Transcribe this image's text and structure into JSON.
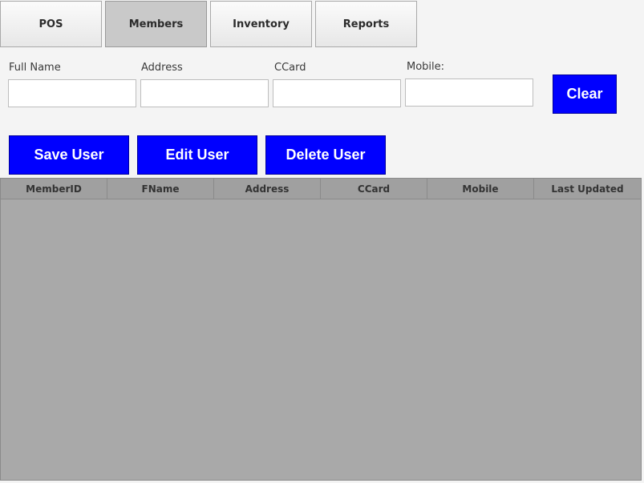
{
  "tabs": [
    {
      "label": "POS"
    },
    {
      "label": "Members"
    },
    {
      "label": "Inventory"
    },
    {
      "label": "Reports"
    }
  ],
  "active_tab": "Members",
  "form": {
    "full_name": {
      "label": "Full Name",
      "value": ""
    },
    "address": {
      "label": "Address",
      "value": ""
    },
    "ccard": {
      "label": "CCard",
      "value": ""
    },
    "mobile": {
      "label": "Mobile:",
      "value": ""
    }
  },
  "buttons": {
    "clear": "Clear",
    "save_user": "Save User",
    "edit_user": "Edit User",
    "delete_user": "Delete User"
  },
  "table": {
    "columns": [
      "MemberID",
      "FName",
      "Address",
      "CCard",
      "Mobile",
      "Last Updated"
    ],
    "rows": []
  },
  "colors": {
    "button_bg": "#0000ff",
    "grid_bg": "#a9a9a9"
  }
}
